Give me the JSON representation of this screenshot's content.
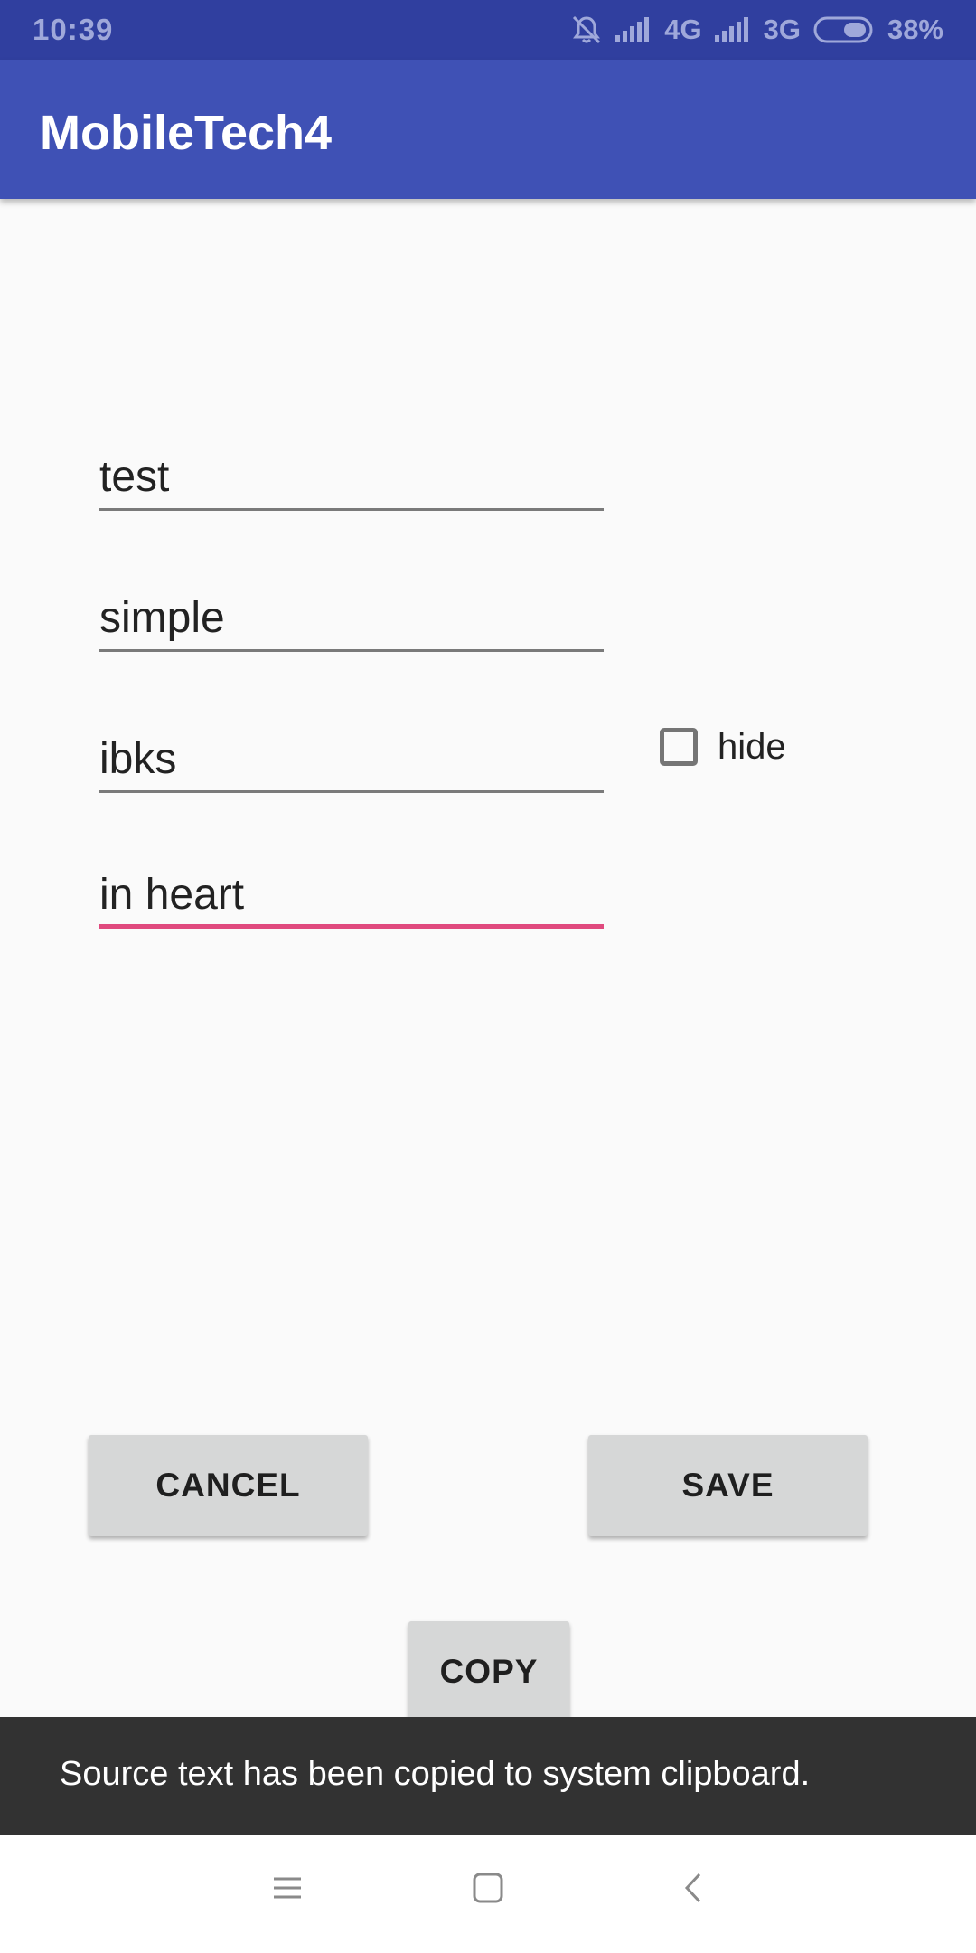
{
  "status_bar": {
    "time": "10:39",
    "network_1": "4G",
    "network_2": "3G",
    "battery": "38%"
  },
  "app_bar": {
    "title": "MobileTech4"
  },
  "form": {
    "fields": [
      {
        "value": "test",
        "focused": false
      },
      {
        "value": "simple",
        "focused": false
      },
      {
        "value": "ibks",
        "focused": false
      },
      {
        "value": "in heart",
        "focused": true
      }
    ],
    "hide_checkbox": {
      "label": "hide",
      "checked": false
    }
  },
  "buttons": {
    "cancel": "CANCEL",
    "save": "SAVE",
    "copy": "COPY"
  },
  "snackbar": {
    "message": "Source text has been copied to system clipboard."
  },
  "nav_bar": {
    "icons": [
      "menu-icon",
      "home-square-icon",
      "back-chevron-icon"
    ]
  },
  "colors": {
    "status_bar": "#303f9f",
    "app_bar": "#3f51b5",
    "accent": "#e04a7e",
    "button": "#d6d7d7",
    "snackbar": "#323232"
  }
}
